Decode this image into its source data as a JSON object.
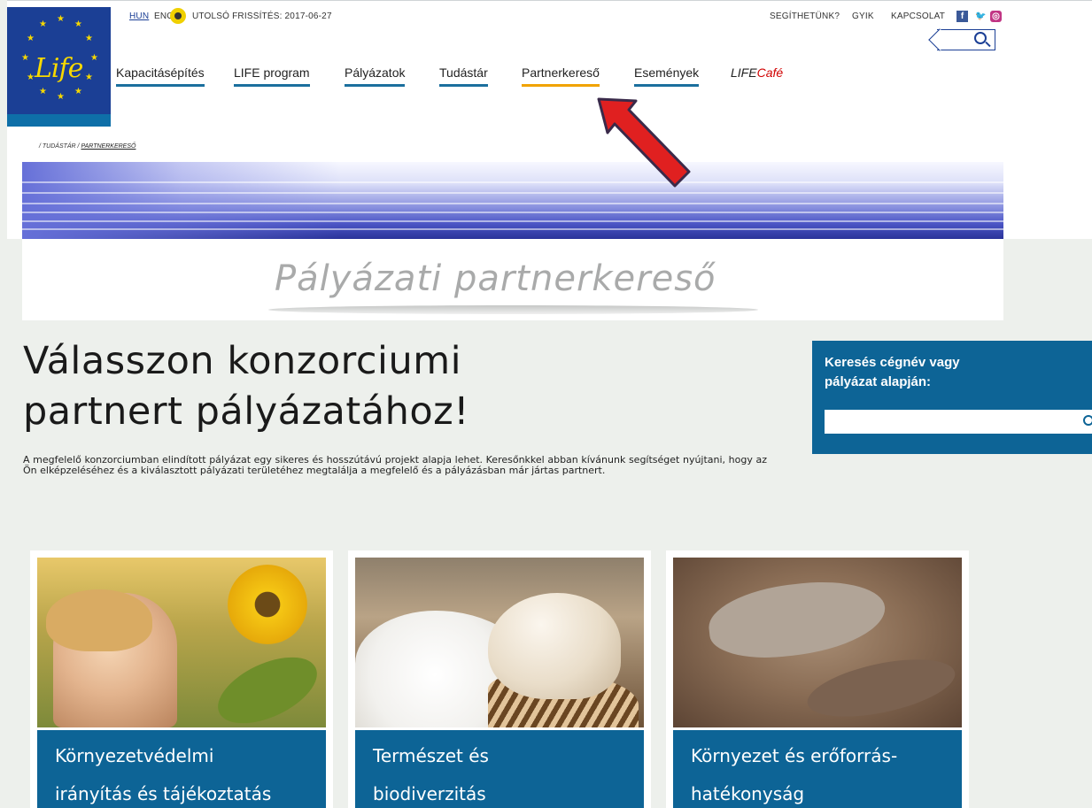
{
  "header": {
    "lang_hun": "HUN",
    "lang_eng": "ENG",
    "update_text": "UTOLSÓ FRISSÍTÉS: 2017-06-27",
    "util_links": [
      "SEGÍTHETÜNK?",
      "GYIK",
      "KAPCSOLAT"
    ],
    "social": {
      "facebook": "f",
      "twitter": "🐦",
      "instagram": "◎"
    }
  },
  "logo": {
    "text": "Life"
  },
  "nav": {
    "items": [
      "Kapacitásépítés",
      "LIFE program",
      "Pályázatok",
      "Tudástár",
      "Partnerkereső",
      "Események"
    ],
    "cafe_life": "LIFE",
    "cafe_cafe": "Café",
    "active": "Partnerkereső"
  },
  "breadcrumb": {
    "parent": "/ TUDÁSTÁR /",
    "current": "PARTNERKERESŐ"
  },
  "page_title": "Pályázati partnerkereső",
  "main": {
    "headline_line1": "Válasszon konzorciumi",
    "headline_line2": "partnert pályázatához!",
    "intro": "A megfelelő konzorciumban elindított pályázat egy sikeres és hosszútávú projekt alapja lehet. Keresőnkkel abban kívánunk segítséget nyújtani, hogy az Ön elképzeléséhez és a kiválasztott pályázati területéhez megtalálja a megfelelő és a pályázásban már jártas partnert."
  },
  "sidebar_search": {
    "label_line1": "Keresés cégnév vagy",
    "label_line2": "pályázat alapján:",
    "value": ""
  },
  "cards": [
    {
      "line1": "Környezetvédelmi",
      "line2": "irányítás és tájékoztatás"
    },
    {
      "line1": "Természet és",
      "line2": "biodiverzitás"
    },
    {
      "line1": "Környezet és erőforrás-",
      "line2": "hatékonyság"
    }
  ],
  "colors": {
    "brand_blue": "#1b3f95",
    "accent_blue": "#0d6496",
    "active_underline": "#f1a300",
    "arrow": "#e02020"
  }
}
